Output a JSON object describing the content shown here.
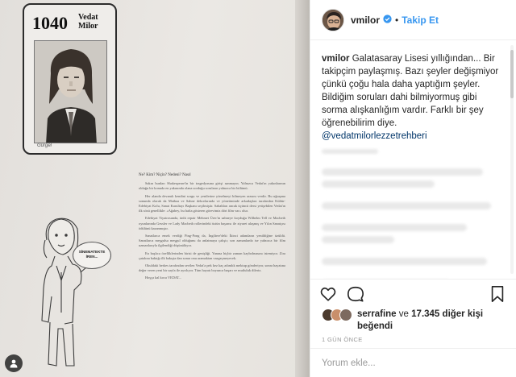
{
  "media": {
    "card_number": "1040",
    "card_name_first": "Vedat",
    "card_name_last": "Milor",
    "card_signature": "Gürgel",
    "article_title": "Ne? Kim? Niçin? Nedeni? Nasıl",
    "article_paragraphs": [
      "Sakın bunları Shakespeare'in bir tragedyasına girişi sanmayın. Yalnızca Vedat'ın yakınlarının olduğu bir konuda en yakınında olana sorduğu soruların yalnızca bir bölümü.",
      "Her alanda devamlı kendini sorgu ve yenilerine yönelmeyi bilmeyen arasını verdir. Bu uğraşma sonunda olarak da Matbaa ve Sahne dekorlarında ve yönetiminde arkadaşları tarafından Kültür-Edebiyat Kolu, Sanat Kurultayı Başkanı seçilmiştir. Sabahları ancak üçüncü dersi yetişebilen Vedat'ın ilk sözü genellikle: «Ağabey, bu hafta gösteren görevimiz dört film var» olur.",
      "Edebiyat Tiyatrosunda, ünlü repair Mehmet Ürer'in sahneye koyduğu Wilhelm Tell ve Macbeth oyunlarında Gessler ve Lady Macbeth rollerindeki üstün başarısı ile ziyaret ulaşmış ve Yılın Sanatçısı ödülünü kazanmıştır.",
      "Sanatlarca emek verdiği Ping-Pong da, İngiltere'deki İkinci adamların yenildiğine üzüldü. Sanatlarca meşgulsa meşgul olduğunu da anlatmaya çalıştı; son zamanlarda ise yalnızca bir film uzmanlarıyla ilgilendiği düşünülüyor.",
      "En başlıca özelliklerinden birisi de genişliği. Yanına hiçbir zaman kaybolmasını istemiyor. Zira çatalına baktığı ilk bakışta dan sonra onu aramaktan vazgeçmeyecek.",
      "Okuldaki herkes tarafından sevilen Vedat'a pek kez kaç adımlık mektup gönderiyor, sonra hayatına değer veren yeni bir sayfa ile ayrılıyor. Tüm hayatı boyunca başarı ve mutluluk dileriz.",
      "Hoşça kal koca VEDAT..."
    ],
    "speech_bubble": "SİNEMATEKTE İREN...",
    "tag_icon": "user-tag-icon"
  },
  "post": {
    "username": "vmilor",
    "follow_label": "Takip Et",
    "caption_username": "vmilor",
    "caption_text": "Galatasaray Lisesi yıllığından... Bir takipçim paylaşmış. Bazı şeyler değişmiyor çünkü çoğu hala daha yaptığım şeyler. Bildiğim soruları dahi bilmiyormuş gibi sorma alışkanlığım vardır. Farklı bir şey öğrenebilirim diye.",
    "caption_mention": "@vedatmilorlezzetrehberi",
    "likes_user": "serrafine",
    "likes_conjunction": "ve",
    "likes_count": "17.345",
    "likes_suffix": "diğer kişi beğendi",
    "posted_time": "1 GÜN ÖNCE",
    "comment_placeholder": "Yorum ekle..."
  },
  "colors": {
    "accent": "#3897f0",
    "mention": "#003569",
    "verified": "#3897f0"
  }
}
